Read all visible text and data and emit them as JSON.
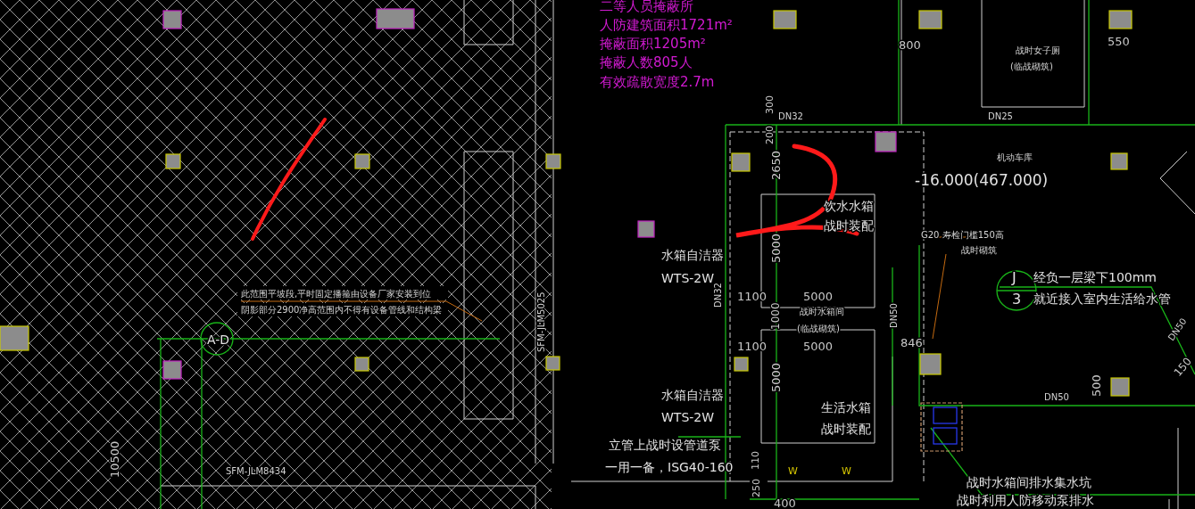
{
  "drawing": {
    "texts": [
      {
        "text": "二等人员掩蔽所",
        "kind": "note"
      },
      {
        "text": "人防建筑面积1721m²",
        "kind": "note"
      },
      {
        "text": "掩蔽面积1205m²",
        "kind": "note"
      },
      {
        "text": "掩蔽人数805人",
        "kind": "note"
      },
      {
        "text": "有效疏散宽度2.7m",
        "kind": "note"
      },
      {
        "text": "800",
        "kind": "dim"
      },
      {
        "text": "战时女子厕",
        "kind": "tag"
      },
      {
        "text": "(临战砌筑)",
        "kind": "tag"
      },
      {
        "text": "550",
        "kind": "dim"
      },
      {
        "text": "300",
        "kind": "dim"
      },
      {
        "text": "DN32",
        "kind": "tag"
      },
      {
        "text": "DN25",
        "kind": "tag"
      },
      {
        "text": "200",
        "kind": "dim"
      },
      {
        "text": "机动车库",
        "kind": "tag"
      },
      {
        "text": "2650",
        "kind": "dim"
      },
      {
        "text": "-16.000(467.000)",
        "kind": "label"
      },
      {
        "text": "饮水水箱",
        "kind": "label"
      },
      {
        "text": "战时装配",
        "kind": "label"
      },
      {
        "text": "G20 寿检门槛150高",
        "kind": "tag"
      },
      {
        "text": "战时砌筑",
        "kind": "tag"
      },
      {
        "text": "5000",
        "kind": "dim"
      },
      {
        "text": "水箱自洁器",
        "kind": "label"
      },
      {
        "text": "WTS-2W",
        "kind": "label"
      },
      {
        "text": "J",
        "kind": "label"
      },
      {
        "text": "3",
        "kind": "label"
      },
      {
        "text": "经负一层梁下100mm",
        "kind": "label"
      },
      {
        "text": "就近接入室内生活给水管",
        "kind": "label"
      },
      {
        "text": "此范围平坡段,平时固定播箍由设备厂家安装到位",
        "kind": "tag"
      },
      {
        "text": "阴影部分2900净高范围内不得有设备管线和结构梁",
        "kind": "tag"
      },
      {
        "text": "DN32",
        "kind": "tag"
      },
      {
        "text": "1100",
        "kind": "dim"
      },
      {
        "text": "5000",
        "kind": "dim"
      },
      {
        "text": "战时水箱间",
        "kind": "tag"
      },
      {
        "text": "SFM-JLM5025",
        "kind": "tag"
      },
      {
        "text": "1000",
        "kind": "dim"
      },
      {
        "text": "DN50",
        "kind": "tag"
      },
      {
        "text": "(临战砌筑)",
        "kind": "tag"
      },
      {
        "text": "A-D",
        "kind": "label"
      },
      {
        "text": "DN50",
        "kind": "tag"
      },
      {
        "text": "846",
        "kind": "dim"
      },
      {
        "text": "1100",
        "kind": "dim"
      },
      {
        "text": "5000",
        "kind": "dim"
      },
      {
        "text": "150",
        "kind": "dim"
      },
      {
        "text": "5000",
        "kind": "dim"
      },
      {
        "text": "500",
        "kind": "dim"
      },
      {
        "text": "DN50",
        "kind": "tag"
      },
      {
        "text": "水箱自洁器",
        "kind": "label"
      },
      {
        "text": "生活水箱",
        "kind": "label"
      },
      {
        "text": "WTS-2W",
        "kind": "label"
      },
      {
        "text": "战时装配",
        "kind": "label"
      },
      {
        "text": "立管上战时设管道泵",
        "kind": "label"
      },
      {
        "text": "10500",
        "kind": "dim"
      },
      {
        "text": "SFM-JLM8434",
        "kind": "tag"
      },
      {
        "text": "一用一备，ISG40-160",
        "kind": "label"
      },
      {
        "text": "110",
        "kind": "dim"
      },
      {
        "text": "W",
        "kind": "pipe"
      },
      {
        "text": "W",
        "kind": "pipe"
      },
      {
        "text": "战时水箱间排水集水坑",
        "kind": "label"
      },
      {
        "text": "250",
        "kind": "dim"
      },
      {
        "text": "400",
        "kind": "dim"
      },
      {
        "text": "战时利用人防移动泵排水",
        "kind": "label"
      }
    ]
  }
}
